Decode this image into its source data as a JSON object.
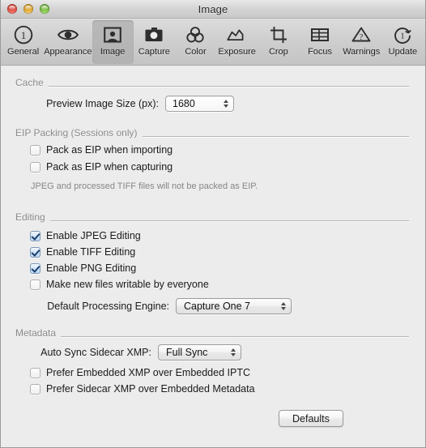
{
  "window": {
    "title": "Image",
    "controls": {
      "close": "close-button",
      "minimize": "minimize-button",
      "zoom": "zoom-button"
    }
  },
  "toolbar": {
    "items": [
      {
        "label": "General",
        "icon": "info-circle-icon",
        "selected": false
      },
      {
        "label": "Appearance",
        "icon": "eye-icon",
        "selected": false
      },
      {
        "label": "Image",
        "icon": "portrait-icon",
        "selected": true
      },
      {
        "label": "Capture",
        "icon": "camera-icon",
        "selected": false
      },
      {
        "label": "Color",
        "icon": "color-circles-icon",
        "selected": false
      },
      {
        "label": "Exposure",
        "icon": "histogram-icon",
        "selected": false
      },
      {
        "label": "Crop",
        "icon": "crop-icon",
        "selected": false
      },
      {
        "label": "Focus",
        "icon": "focus-grid-icon",
        "selected": false
      },
      {
        "label": "Warnings",
        "icon": "warning-triangle-icon",
        "selected": false
      },
      {
        "label": "Update",
        "icon": "update-circle-icon",
        "selected": false
      }
    ]
  },
  "sections": {
    "cache": {
      "header": "Cache",
      "preview_size_label": "Preview Image Size (px):",
      "preview_size_value": "1680"
    },
    "eip": {
      "header": "EIP Packing (Sessions only)",
      "pack_importing_label": "Pack as EIP when importing",
      "pack_importing_checked": false,
      "pack_capturing_label": "Pack as EIP when capturing",
      "pack_capturing_checked": false,
      "note": "JPEG and processed TIFF files will not be packed as EIP."
    },
    "editing": {
      "header": "Editing",
      "jpeg_label": "Enable JPEG Editing",
      "jpeg_checked": true,
      "tiff_label": "Enable TIFF Editing",
      "tiff_checked": true,
      "png_label": "Enable PNG Editing",
      "png_checked": true,
      "writable_label": "Make new files writable by everyone",
      "writable_checked": false,
      "engine_label": "Default Processing Engine:",
      "engine_value": "Capture One 7"
    },
    "metadata": {
      "header": "Metadata",
      "autosync_label": "Auto Sync Sidecar XMP:",
      "autosync_value": "Full Sync",
      "prefer_embedded_label": "Prefer Embedded XMP over Embedded IPTC",
      "prefer_embedded_checked": false,
      "prefer_sidecar_label": "Prefer Sidecar XMP over Embedded Metadata",
      "prefer_sidecar_checked": false
    }
  },
  "footer": {
    "defaults_label": "Defaults"
  },
  "colors": {
    "window_bg": "#ececec",
    "toolbar_top": "#dcdcdc",
    "section_header_text": "#8b8b8b",
    "checkbox_check": "#1c3f6e",
    "checkbox_fill": "#cfe3f7"
  }
}
